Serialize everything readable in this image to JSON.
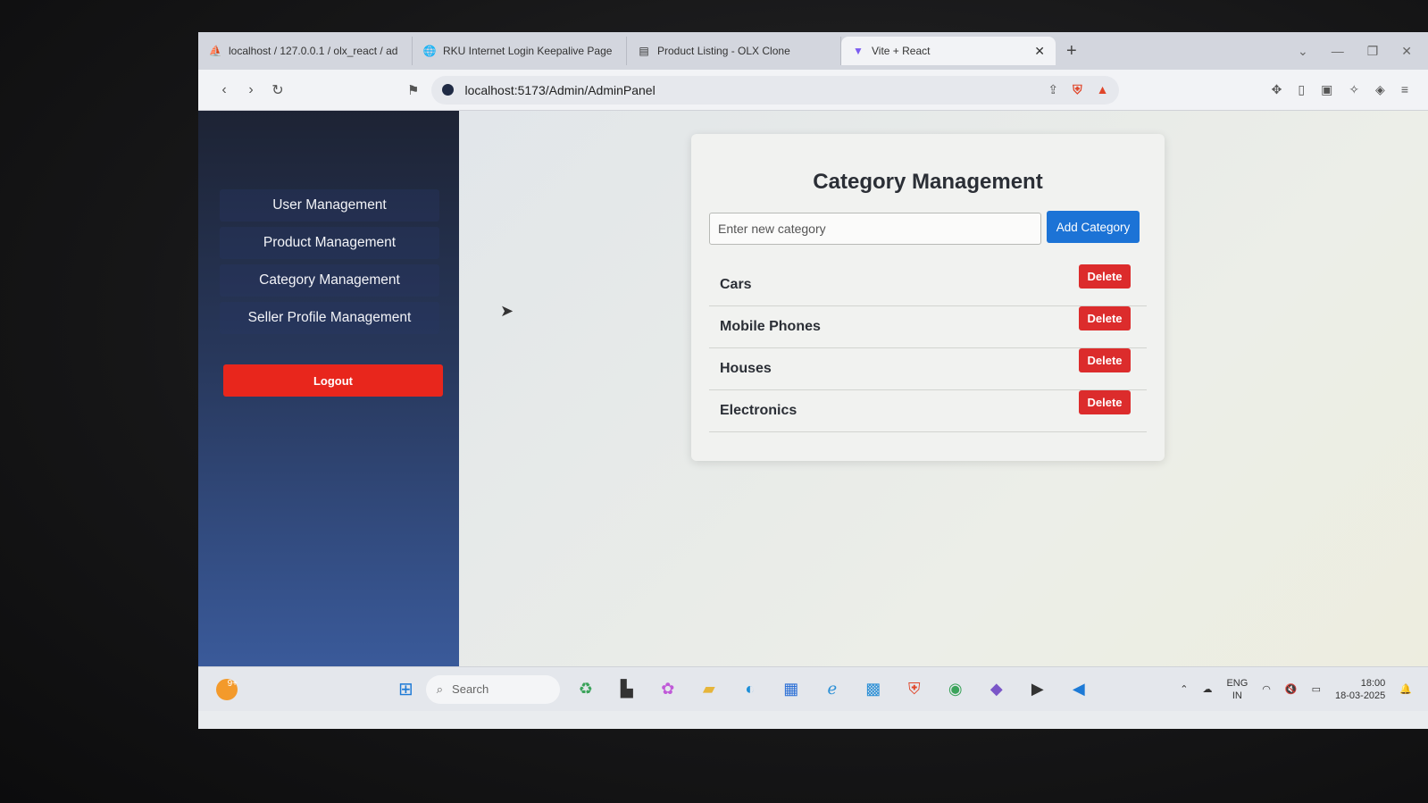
{
  "browser": {
    "tabs": [
      {
        "label": "localhost / 127.0.0.1 / olx_react / ad",
        "icon": "phpmyadmin-icon",
        "active": false
      },
      {
        "label": "RKU Internet Login Keepalive Page",
        "icon": "globe-icon",
        "active": false
      },
      {
        "label": "Product Listing - OLX Clone",
        "icon": "page-icon",
        "active": false
      },
      {
        "label": "Vite + React",
        "icon": "vite-icon",
        "active": true
      }
    ],
    "url": "localhost:5173/Admin/AdminPanel"
  },
  "sidebar": {
    "items": [
      {
        "label": "User Management"
      },
      {
        "label": "Product Management"
      },
      {
        "label": "Category Management"
      },
      {
        "label": "Seller Profile Management"
      }
    ],
    "logout_label": "Logout"
  },
  "main": {
    "title": "Category Management",
    "input_placeholder": "Enter new category",
    "add_label": "Add Category",
    "categories": [
      {
        "name": "Cars",
        "delete_label": "Delete"
      },
      {
        "name": "Mobile Phones",
        "delete_label": "Delete"
      },
      {
        "name": "Houses",
        "delete_label": "Delete"
      },
      {
        "name": "Electronics",
        "delete_label": "Delete"
      }
    ]
  },
  "taskbar": {
    "search_placeholder": "Search",
    "notif_count": "9+",
    "language": "ENG",
    "region": "IN",
    "time": "18:00",
    "date": "18-03-2025"
  },
  "colors": {
    "accent_blue": "#1c73d6",
    "danger_red": "#dc2c2c",
    "logout_red": "#e8261c",
    "sidebar_top": "#1d2334",
    "sidebar_bottom": "#3a5a9a"
  }
}
